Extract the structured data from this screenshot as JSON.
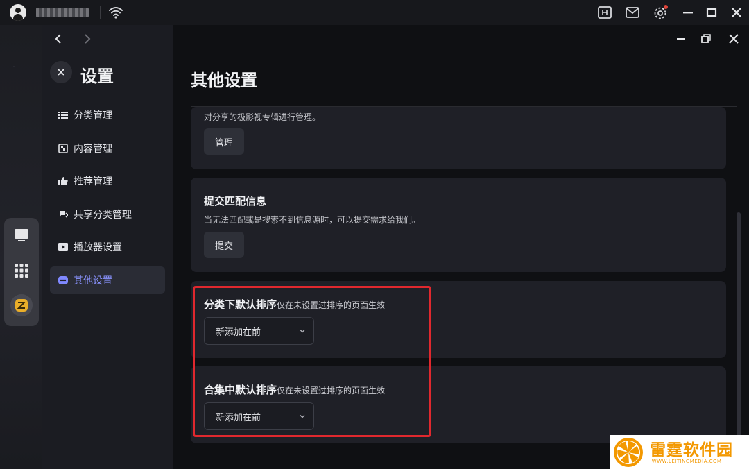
{
  "os_bar": {
    "icons": [
      "avatar-icon",
      "wifi-icon",
      "screen-capture-icon",
      "mail-icon",
      "settings-icon"
    ],
    "window_controls": [
      "minimize-icon",
      "maximize-icon",
      "close-icon"
    ],
    "notification_dot_color": "#e0453a"
  },
  "dock": {
    "items": [
      "tv-icon",
      "apps-grid-icon",
      "leiting-app-icon"
    ]
  },
  "sidebar": {
    "title": "设置",
    "items": [
      {
        "label": "分类管理",
        "icon": "list-icon",
        "active": false
      },
      {
        "label": "内容管理",
        "icon": "content-icon",
        "active": false
      },
      {
        "label": "推荐管理",
        "icon": "thumbs-up-icon",
        "active": false
      },
      {
        "label": "共享分类管理",
        "icon": "share-icon",
        "active": false
      },
      {
        "label": "播放器设置",
        "icon": "play-icon",
        "active": false
      },
      {
        "label": "其他设置",
        "icon": "more-icon",
        "active": true
      }
    ]
  },
  "main": {
    "title": "其他设置",
    "cards": {
      "manage": {
        "description": "对分享的极影视专辑进行管理。",
        "button": "管理"
      },
      "submit": {
        "heading": "提交匹配信息",
        "description": "当无法匹配或是搜索不到信息源时，可以提交需求给我们。",
        "button": "提交"
      },
      "category_sort": {
        "heading": "分类下默认排序",
        "note": "仅在未设置过排序的页面生效",
        "value": "新添加在前"
      },
      "collection_sort": {
        "heading": "合集中默认排序",
        "note": "仅在未设置过排序的页面生效",
        "value": "新添加在前"
      }
    }
  },
  "colors": {
    "accent": "#8a93ff",
    "highlight": "#e0282e",
    "card_bg": "#1f2027"
  },
  "watermark": {
    "title": "雷霆软件园",
    "url": "WWW.LEITINGMEDIA.COM"
  }
}
